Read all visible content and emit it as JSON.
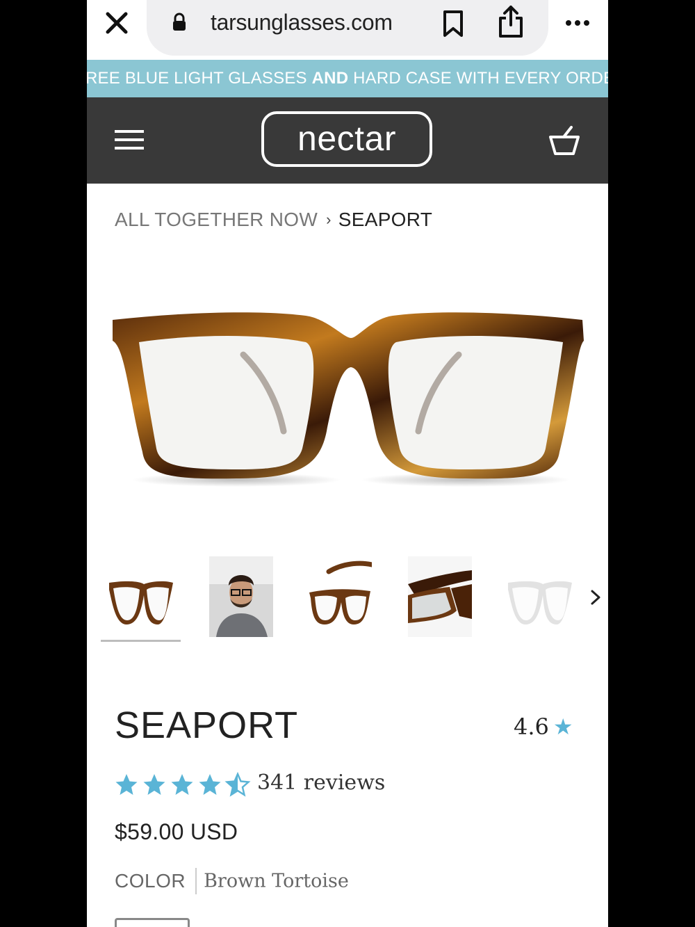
{
  "browser": {
    "url": "tarsunglasses.com",
    "close_icon": "close-icon",
    "lock_icon": "lock-icon",
    "bookmark_icon": "bookmark-icon",
    "share_icon": "share-icon",
    "more_icon": "more-icon"
  },
  "announcement": {
    "part1": "REE BLUE LIGHT GLASSES ",
    "part2": "AND",
    "part3": " HARD CASE WITH EVERY ORDER"
  },
  "header": {
    "logo": "nectar",
    "menu_icon": "hamburger-menu-icon",
    "cart_icon": "basket-icon"
  },
  "breadcrumb": {
    "parent": "ALL TOGETHER NOW",
    "separator": "›",
    "current": "SEAPORT"
  },
  "product": {
    "title": "SEAPORT",
    "rating_value": "4.6",
    "rating_star": "★",
    "stars_filled": 4.5,
    "review_count": "341 reviews",
    "price": "$59.00 USD",
    "color_label": "COLOR",
    "color_value": "Brown Tortoise"
  },
  "gallery": {
    "thumbnails": [
      "front-view",
      "model-photo",
      "side-angle",
      "folded-view",
      "clear-frame"
    ],
    "selected_index": 0
  },
  "colors": {
    "announcement_bg": "#8bc6d3",
    "header_bg": "#393939",
    "star": "#5ab4d6"
  }
}
